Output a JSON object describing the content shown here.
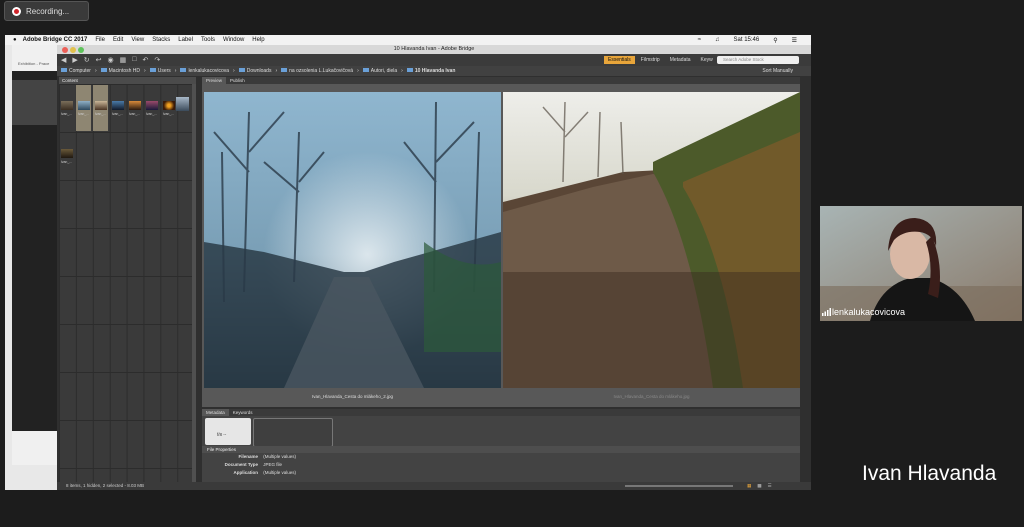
{
  "recording": {
    "label": "Recording..."
  },
  "mac_menubar": {
    "app": "Adobe Bridge CC 2017",
    "items": [
      "File",
      "Edit",
      "View",
      "Stacks",
      "Label",
      "Tools",
      "Window",
      "Help"
    ],
    "clock": "Sat 15:46"
  },
  "browser_bg": {
    "tab_text": "Exhibition - Prace"
  },
  "bridge": {
    "window_title": "10 Hlavanda Ivan - Adobe Bridge",
    "workspaces": [
      "Essentials",
      "Filmstrip",
      "Metadata",
      "Keyw"
    ],
    "active_workspace": "Essentials",
    "search_placeholder": "Search Adobe Stock",
    "path": [
      "Computer",
      "Macintosh HD",
      "Users",
      "lenkalukacovicova",
      "Downloads",
      "na ozsolenia L.Lukačovičová",
      "Autori, diela",
      "10 Hlavanda Ivan"
    ],
    "sort_label": "Sort Manually",
    "content_tab": "Content",
    "thumbnails": [
      {
        "label": "Ivan_..."
      },
      {
        "label": "Ivan_..."
      },
      {
        "label": "Ivan_..."
      },
      {
        "label": "Ivan_..."
      },
      {
        "label": "Ivan_..."
      },
      {
        "label": "Ivan_..."
      },
      {
        "label": "Ivan_..."
      },
      {
        "label": "Ivan_..."
      }
    ],
    "preview_tabs": [
      "Preview",
      "Publish"
    ],
    "captions": [
      "Ivan_Hlavanda_Cesta do mlákeho_2.jpg",
      "Ivan_Hlavanda_Cesta do mlákeho.jpg"
    ],
    "meta_tabs": [
      "Metadata",
      "Keywords"
    ],
    "placard_value": "f/8 --",
    "file_properties": {
      "header": "File Properties",
      "rows": [
        {
          "key": "Filename",
          "value": "(Multiple values)"
        },
        {
          "key": "Document Type",
          "value": "JPEG file"
        },
        {
          "key": "Application",
          "value": "(Multiple values)"
        }
      ]
    },
    "status": "8 items, 1 hidden, 2 selected - 8.03 MB"
  },
  "webcam": {
    "name": "lenkalukacovicova"
  },
  "speaker_name": "Ivan Hlavanda",
  "colors": {
    "accent": "#e8a53a",
    "selected_thumb": "#8e8672",
    "rec_dot": "#d0252c"
  }
}
